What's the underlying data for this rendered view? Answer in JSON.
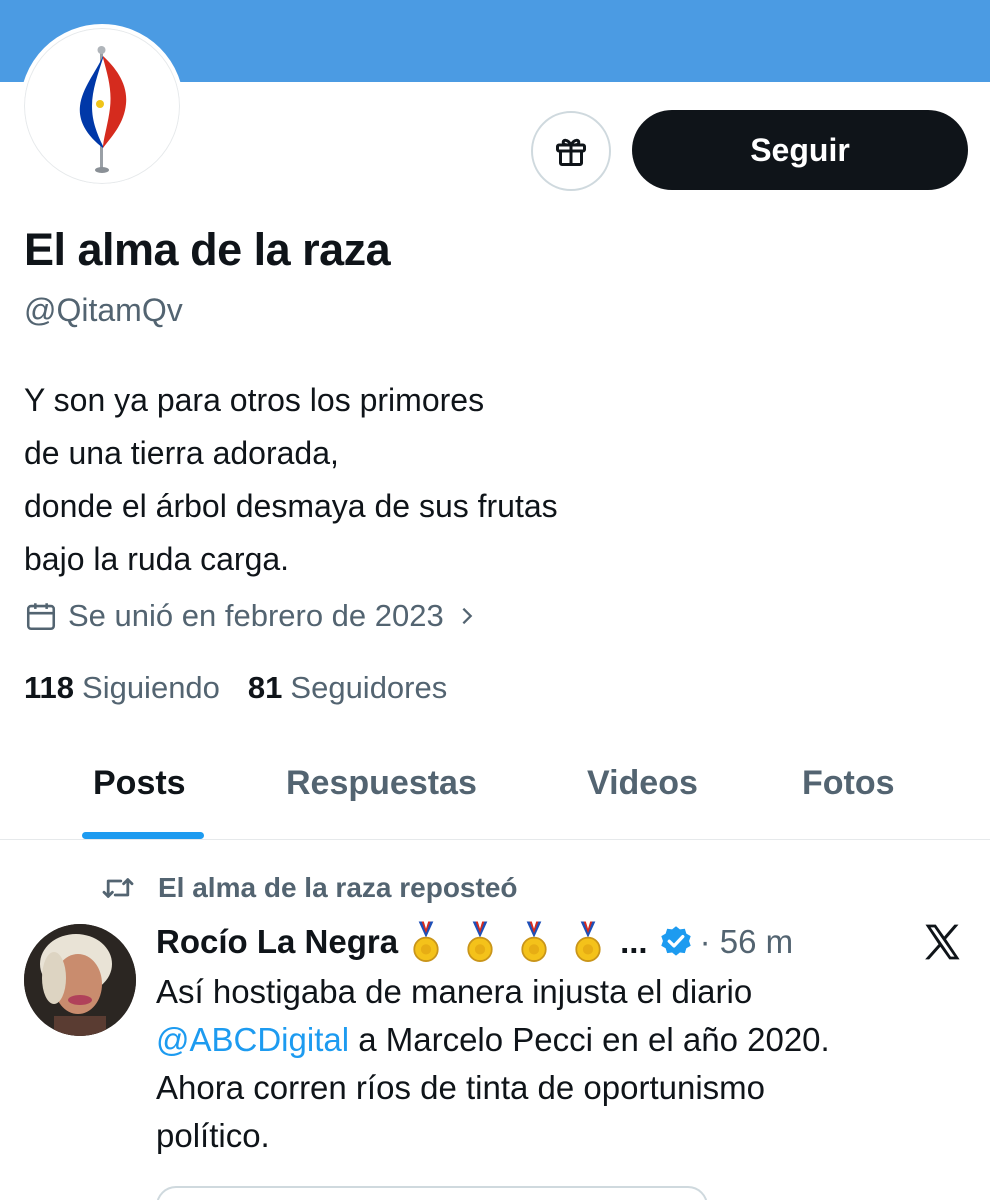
{
  "profile": {
    "display_name": "El alma de la raza",
    "handle": "@QitamQv",
    "bio_lines": [
      "Y son ya para otros los primores",
      "de una tierra adorada,",
      "donde el árbol desmaya de sus frutas",
      "bajo la ruda carga."
    ],
    "joined": "Se unió en febrero de 2023",
    "following_count": "118",
    "following_label": "Siguiendo",
    "followers_count": "81",
    "followers_label": "Seguidores",
    "banner_color": "#4b9be3"
  },
  "actions": {
    "gift_icon": "gift-icon",
    "follow_label": "Seguir"
  },
  "tabs": [
    {
      "label": "Posts",
      "active": true
    },
    {
      "label": "Respuestas",
      "active": false
    },
    {
      "label": "Videos",
      "active": false
    },
    {
      "label": "Fotos",
      "active": false
    }
  ],
  "post": {
    "repost_label": "El alma de la raza reposteó",
    "author": "Rocío La Negra",
    "medal_icon": "medal-icon",
    "medal_count": 4,
    "ellipsis": "...",
    "verified_icon": "verified-badge-icon",
    "time": "· 56 m",
    "source_icon": "x-logo-icon",
    "text_line1": "Así hostigaba de manera injusta el diario",
    "mention": "@ABCDigital",
    "text_line2_rest": " a Marcelo Pecci en el año 2020.",
    "text_line3": "Ahora corren ríos de tinta  de oportunismo",
    "text_line4": "político."
  },
  "colors": {
    "accent": "#1d9bf0",
    "text_primary": "#0f1419",
    "text_secondary": "#536471"
  }
}
